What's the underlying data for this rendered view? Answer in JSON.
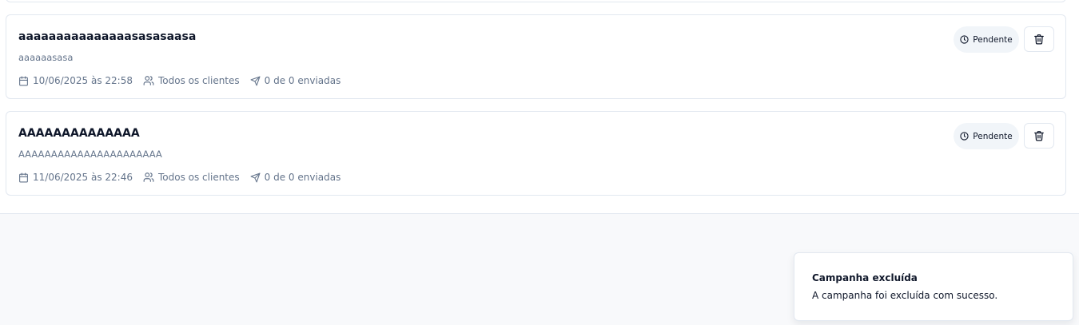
{
  "campaigns": [
    {
      "title": "aaaaaaaaaaaaaaasasasaasa",
      "description": "aaaaaasasa",
      "date": "10/06/2025 às 22:58",
      "audience": "Todos os clientes",
      "sent": "0 de 0 enviadas",
      "status": "Pendente"
    },
    {
      "title": "AAAAAAAAAAAAAA",
      "description": "AAAAAAAAAAAAAAAAAAAAAA",
      "date": "11/06/2025 às 22:46",
      "audience": "Todos os clientes",
      "sent": "0 de 0 enviadas",
      "status": "Pendente"
    }
  ],
  "toast": {
    "title": "Campanha excluída",
    "message": "A campanha foi excluída com sucesso."
  },
  "icons": {
    "date": "calendar-icon",
    "audience": "users-icon",
    "sent": "send-icon",
    "status": "clock-icon",
    "delete": "trash-icon"
  },
  "colors": {
    "muted_text": "#64748b",
    "border": "#e2e8f0",
    "badge_bg": "#f1f5f9"
  }
}
